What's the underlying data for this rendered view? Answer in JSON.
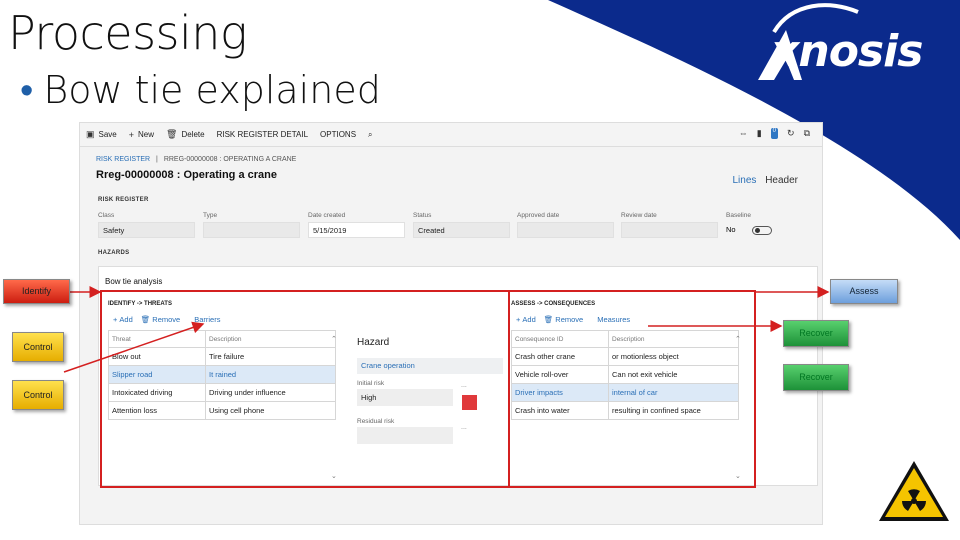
{
  "slide": {
    "title": "Processing",
    "bullet": "Bow tie explained",
    "brand": "xnosis"
  },
  "toolbar": {
    "save": "Save",
    "new": "New",
    "delete": "Delete",
    "detail": "RISK REGISTER DETAIL",
    "options": "OPTIONS",
    "badge": "0"
  },
  "breadcrumb": {
    "root": "RISK REGISTER",
    "sep": "|",
    "current": "RREG-00000008 : OPERATING A CRANE"
  },
  "record": {
    "title": "Rreg-00000008 : Operating a crane",
    "view_lines": "Lines",
    "view_header": "Header"
  },
  "risk_register": {
    "section": "RISK REGISTER",
    "fields": [
      {
        "label": "Class",
        "value": "Safety"
      },
      {
        "label": "Type",
        "value": ""
      },
      {
        "label": "Date created",
        "value": "5/15/2019"
      },
      {
        "label": "Status",
        "value": "Created"
      },
      {
        "label": "Approved date",
        "value": ""
      },
      {
        "label": "Review date",
        "value": ""
      },
      {
        "label": "Baseline",
        "value": "No"
      }
    ]
  },
  "hazards": {
    "section": "HAZARDS",
    "bowtie_title": "Bow tie analysis",
    "threats": {
      "title": "IDENTIFY -> THREATS",
      "add": "Add",
      "remove": "Remove",
      "barriers": "Barriers",
      "col1": "Threat",
      "col2": "Description",
      "rows": [
        {
          "threat": "Blow out",
          "desc": "Tire failure"
        },
        {
          "threat": "Slipper road",
          "desc": "It rained"
        },
        {
          "threat": "Intoxicated driving",
          "desc": "Driving under influence"
        },
        {
          "threat": "Attention loss",
          "desc": "Using cell phone"
        }
      ]
    },
    "hazard": {
      "title": "Hazard",
      "operation": "Crane operation",
      "initial_label": "Initial risk",
      "initial_value": "High",
      "residual_label": "Residual risk",
      "residual_value": "",
      "more": "...",
      "risk_color": "#e0393b"
    },
    "consequences": {
      "title": "ASSESS -> CONSEQUENCES",
      "add": "Add",
      "remove": "Remove",
      "measures": "Measures",
      "col1": "Consequence ID",
      "col2": "Description",
      "rows": [
        {
          "id": "Crash other crane",
          "desc": "or motionless object"
        },
        {
          "id": "Vehicle roll-over",
          "desc": "Can not exit vehicle"
        },
        {
          "id": "Driver impacts",
          "desc": "internal of car"
        },
        {
          "id": "Crash into water",
          "desc": "resulting in confined space"
        }
      ]
    }
  },
  "tags": {
    "identify": "Identify",
    "control1": "Control",
    "control2": "Control",
    "assess": "Assess",
    "recover1": "Recover",
    "recover2": "Recover"
  },
  "colors": {
    "brand_blue": "#0b2a8c",
    "annotation_red": "#d42020",
    "link_blue": "#2a6fb6"
  }
}
